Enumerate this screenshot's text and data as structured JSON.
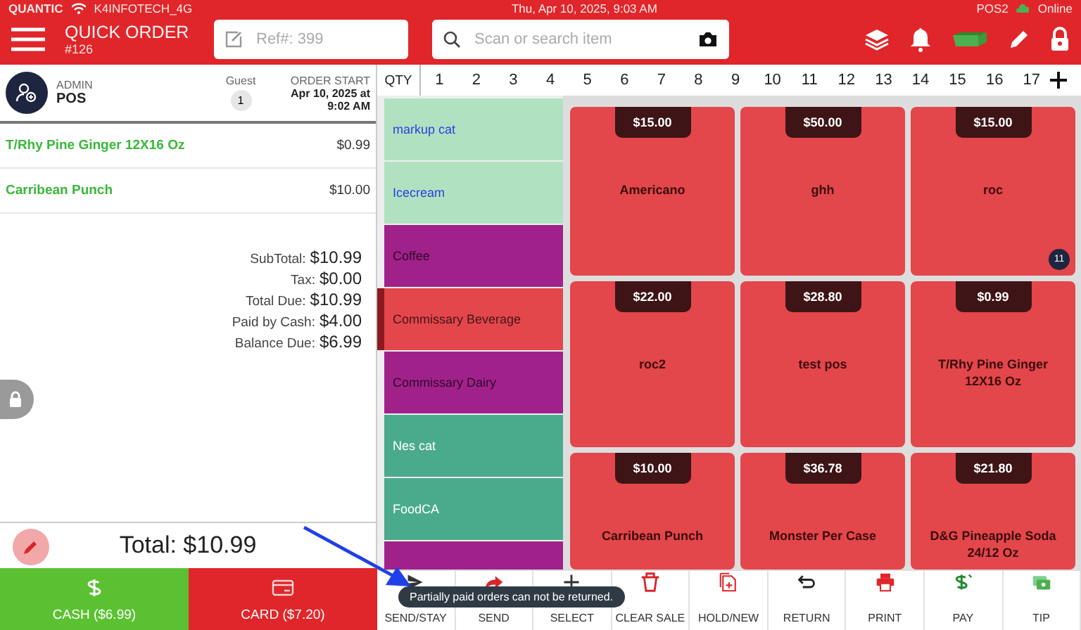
{
  "status_bar": {
    "brand": "QUANTIC",
    "network": "K4INFOTECH_4G",
    "datetime": "Thu, Apr 10, 2025, 9:03 AM",
    "terminal": "POS2",
    "connection": "Online"
  },
  "header": {
    "title": "QUICK ORDER",
    "order_number": "#126",
    "ref_field": {
      "placeholder": "Ref#: 399"
    },
    "search": {
      "placeholder": "Scan or search item"
    }
  },
  "order": {
    "user_role": "ADMIN",
    "user_name": "POS",
    "guest_label": "Guest",
    "guest_count": "1",
    "start_label": "ORDER START",
    "start_date": "Apr 10, 2025 at",
    "start_time": "9:02 AM",
    "items": [
      {
        "name": "T/Rhy Pine Ginger 12X16 Oz",
        "price": "$0.99"
      },
      {
        "name": "Carribean Punch",
        "price": "$10.00"
      }
    ],
    "totals": [
      {
        "label": "SubTotal:",
        "value": "$10.99"
      },
      {
        "label": "Tax:",
        "value": "$0.00"
      },
      {
        "label": "Total Due:",
        "value": "$10.99"
      },
      {
        "label": "Paid by Cash:",
        "value": "$4.00"
      },
      {
        "label": "Balance Due:",
        "value": "$6.99"
      }
    ],
    "total": "Total: $10.99",
    "payments": [
      {
        "kind": "cash",
        "label": "CASH ($6.99)"
      },
      {
        "kind": "card",
        "label": "CARD ($7.20)"
      }
    ]
  },
  "qty": {
    "label": "QTY",
    "numbers": [
      "1",
      "2",
      "3",
      "4",
      "5",
      "6",
      "7",
      "8",
      "9",
      "10",
      "11",
      "12",
      "13",
      "14",
      "15",
      "16",
      "17"
    ]
  },
  "categories": [
    {
      "label": "markup cat",
      "color": "#b0e2c2",
      "selected": false
    },
    {
      "label": "Icecream",
      "color": "#b0e2c2",
      "selected": false
    },
    {
      "label": "Coffee",
      "color": "#a1218b",
      "selected": false
    },
    {
      "label": "Commissary Beverage",
      "color": "#e3464b",
      "selected": true
    },
    {
      "label": "Commissary Dairy",
      "color": "#a1218b",
      "selected": false
    },
    {
      "label": "Nes cat",
      "color": "#4aab8c",
      "selected": false
    },
    {
      "label": "FoodCA",
      "color": "#4aab8c",
      "selected": false
    },
    {
      "color": "#a1218b",
      "selected": false
    }
  ],
  "products": [
    {
      "price": "$15.00",
      "name": "Americano"
    },
    {
      "price": "$50.00",
      "name": "ghh"
    },
    {
      "price": "$15.00",
      "name": "roc",
      "count": "11"
    },
    {
      "price": "$22.00",
      "name": "roc2"
    },
    {
      "price": "$28.80",
      "name": "test pos"
    },
    {
      "price": "$0.99",
      "name": "T/Rhy Pine Ginger 12X16 Oz"
    },
    {
      "price": "$10.00",
      "name": "Carribean Punch"
    },
    {
      "price": "$36.78",
      "name": "Monster Per Case"
    },
    {
      "price": "$21.80",
      "name": "D&G Pineapple Soda 24/12 Oz"
    }
  ],
  "actions": [
    {
      "kind": "send-stay",
      "label": "SEND/STAY"
    },
    {
      "kind": "send",
      "label": "SEND"
    },
    {
      "kind": "select",
      "label": "SELECT"
    },
    {
      "kind": "clear",
      "label": "CLEAR SALE"
    },
    {
      "kind": "hold",
      "label": "HOLD/NEW"
    },
    {
      "kind": "return",
      "label": "RETURN"
    },
    {
      "kind": "print",
      "label": "PRINT"
    },
    {
      "kind": "pay",
      "label": "PAY"
    },
    {
      "kind": "tip",
      "label": "TIP"
    }
  ],
  "toast": "Partially paid orders can not be returned."
}
